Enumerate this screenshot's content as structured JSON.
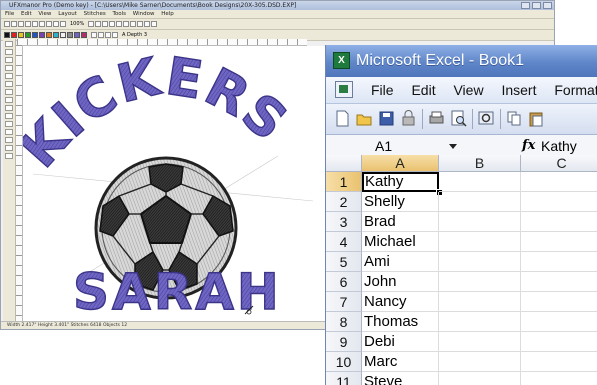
{
  "emb": {
    "title": "UFXmanor Pro (Demo key) - [C:\\Users\\Mike Sarner\\Documents\\Book Designs\\20X-305.DSD.EXP]",
    "menu": [
      "File",
      "Edit",
      "View",
      "Layout",
      "Stitches",
      "Tools",
      "Window",
      "Help"
    ],
    "toolbar_text": "100%",
    "toolbar2_text": "A  Depth 3",
    "design_top_text": "KICKERS",
    "design_bottom_text": "SARAH",
    "thread_color": "#6f66c4",
    "status": "Width 2.417\"   Height 3.401\"   Stitches 6418   Objects 12"
  },
  "excel": {
    "title": "Microsoft Excel - Book1",
    "menu": [
      "File",
      "Edit",
      "View",
      "Insert",
      "Format"
    ],
    "name_box": "A1",
    "fx_label": "fx",
    "formula_value": "Kathy",
    "columns": [
      "A",
      "B",
      "C"
    ],
    "rows": [
      {
        "num": "1",
        "a": "Kathy"
      },
      {
        "num": "2",
        "a": "Shelly"
      },
      {
        "num": "3",
        "a": "Brad"
      },
      {
        "num": "4",
        "a": "Michael"
      },
      {
        "num": "5",
        "a": "Ami"
      },
      {
        "num": "6",
        "a": "John"
      },
      {
        "num": "7",
        "a": "Nancy"
      },
      {
        "num": "8",
        "a": "Thomas"
      },
      {
        "num": "9",
        "a": "Debi"
      },
      {
        "num": "10",
        "a": "Marc"
      },
      {
        "num": "11",
        "a": "Steve"
      }
    ],
    "accent": "#5f86c9"
  }
}
